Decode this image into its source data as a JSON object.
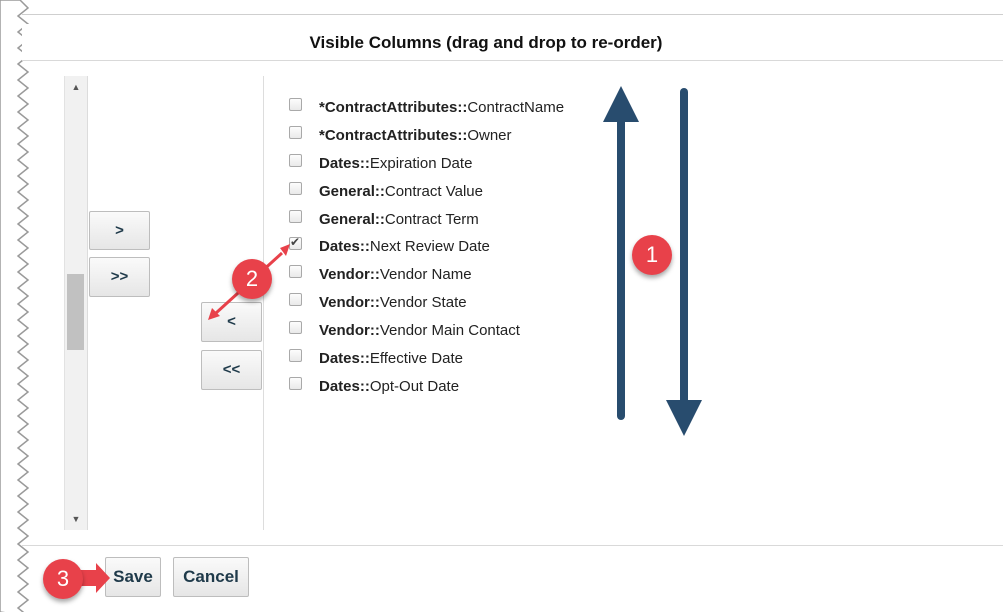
{
  "dialog": {
    "title": "Visible Columns (drag and drop to re-order)"
  },
  "buttons": {
    "add_label": ">",
    "add_all_label": ">>",
    "remove_label": "<",
    "remove_all_label": "<<",
    "save_label": "Save",
    "cancel_label": "Cancel"
  },
  "columns": [
    {
      "prefix": "*ContractAttributes::",
      "name": "ContractName",
      "checked": false
    },
    {
      "prefix": "*ContractAttributes::",
      "name": "Owner",
      "checked": false
    },
    {
      "prefix": "Dates::",
      "name": "Expiration Date",
      "checked": false
    },
    {
      "prefix": "General::",
      "name": "Contract Value",
      "checked": false
    },
    {
      "prefix": "General::",
      "name": "Contract Term",
      "checked": false
    },
    {
      "prefix": "Dates::",
      "name": "Next Review Date",
      "checked": true
    },
    {
      "prefix": "Vendor::",
      "name": "Vendor Name",
      "checked": false
    },
    {
      "prefix": "Vendor::",
      "name": "Vendor State",
      "checked": false
    },
    {
      "prefix": "Vendor::",
      "name": "Vendor Main Contact",
      "checked": false
    },
    {
      "prefix": "Dates::",
      "name": "Effective Date",
      "checked": false
    },
    {
      "prefix": "Dates::",
      "name": "Opt-Out Date",
      "checked": false
    }
  ],
  "callouts": {
    "one": "1",
    "two": "2",
    "three": "3"
  },
  "colors": {
    "callout": "#e8414a",
    "arrow": "#284c6e",
    "button_text": "#1f3a4a"
  },
  "icons": {
    "scroll_up": "triangle-up-icon",
    "scroll_down": "triangle-down-icon"
  }
}
